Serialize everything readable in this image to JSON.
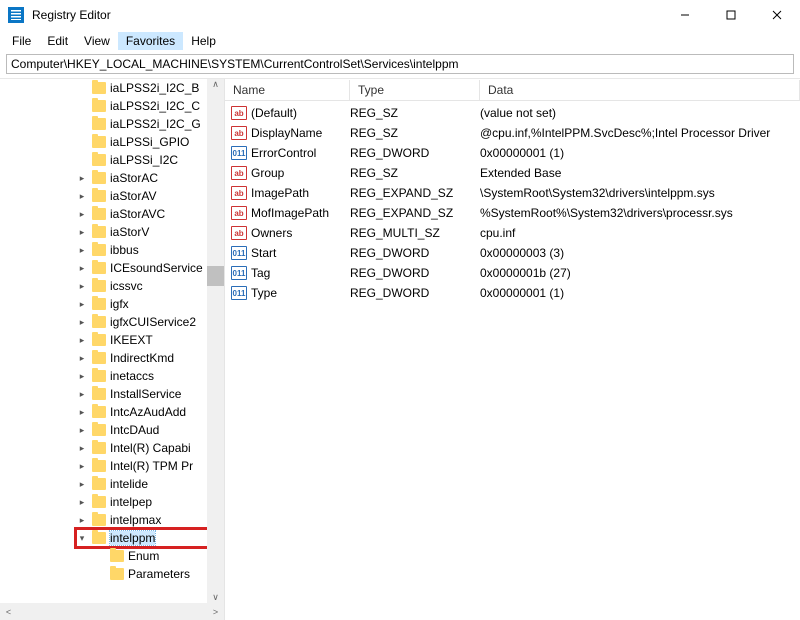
{
  "app": {
    "title": "Registry Editor"
  },
  "menu": {
    "file": "File",
    "edit": "Edit",
    "view": "View",
    "favorites": "Favorites",
    "help": "Help"
  },
  "address": "Computer\\HKEY_LOCAL_MACHINE\\SYSTEM\\CurrentControlSet\\Services\\intelppm",
  "tree": [
    {
      "label": "iaLPSS2i_I2C_B",
      "exp": ""
    },
    {
      "label": "iaLPSS2i_I2C_C",
      "exp": ""
    },
    {
      "label": "iaLPSS2i_I2C_G",
      "exp": ""
    },
    {
      "label": "iaLPSSi_GPIO",
      "exp": ""
    },
    {
      "label": "iaLPSSi_I2C",
      "exp": ""
    },
    {
      "label": "iaStorAC",
      "exp": ">"
    },
    {
      "label": "iaStorAV",
      "exp": ">"
    },
    {
      "label": "iaStorAVC",
      "exp": ">"
    },
    {
      "label": "iaStorV",
      "exp": ">"
    },
    {
      "label": "ibbus",
      "exp": ">"
    },
    {
      "label": "ICEsoundService",
      "exp": ">"
    },
    {
      "label": "icssvc",
      "exp": ">"
    },
    {
      "label": "igfx",
      "exp": ">"
    },
    {
      "label": "igfxCUIService2",
      "exp": ">"
    },
    {
      "label": "IKEEXT",
      "exp": ">"
    },
    {
      "label": "IndirectKmd",
      "exp": ">"
    },
    {
      "label": "inetaccs",
      "exp": ">"
    },
    {
      "label": "InstallService",
      "exp": ">"
    },
    {
      "label": "IntcAzAudAdd",
      "exp": ">"
    },
    {
      "label": "IntcDAud",
      "exp": ">"
    },
    {
      "label": "Intel(R) Capabi",
      "exp": ">"
    },
    {
      "label": "Intel(R) TPM Pr",
      "exp": ">"
    },
    {
      "label": "intelide",
      "exp": ">"
    },
    {
      "label": "intelpep",
      "exp": ">"
    },
    {
      "label": "intelpmax",
      "exp": ">"
    },
    {
      "label": "intelppm",
      "exp": "v",
      "selected": true,
      "highlighted": true
    },
    {
      "label": "Enum",
      "exp": "",
      "child": true
    },
    {
      "label": "Parameters",
      "exp": "",
      "child": true
    }
  ],
  "columns": {
    "name": "Name",
    "type": "Type",
    "data": "Data"
  },
  "values": [
    {
      "icon": "sz",
      "name": "(Default)",
      "type": "REG_SZ",
      "data": "(value not set)"
    },
    {
      "icon": "sz",
      "name": "DisplayName",
      "type": "REG_SZ",
      "data": "@cpu.inf,%IntelPPM.SvcDesc%;Intel Processor Driver"
    },
    {
      "icon": "dw",
      "name": "ErrorControl",
      "type": "REG_DWORD",
      "data": "0x00000001 (1)"
    },
    {
      "icon": "sz",
      "name": "Group",
      "type": "REG_SZ",
      "data": "Extended Base"
    },
    {
      "icon": "sz",
      "name": "ImagePath",
      "type": "REG_EXPAND_SZ",
      "data": "\\SystemRoot\\System32\\drivers\\intelppm.sys"
    },
    {
      "icon": "sz",
      "name": "MofImagePath",
      "type": "REG_EXPAND_SZ",
      "data": "%SystemRoot%\\System32\\drivers\\processr.sys"
    },
    {
      "icon": "sz",
      "name": "Owners",
      "type": "REG_MULTI_SZ",
      "data": "cpu.inf"
    },
    {
      "icon": "dw",
      "name": "Start",
      "type": "REG_DWORD",
      "data": "0x00000003 (3)"
    },
    {
      "icon": "dw",
      "name": "Tag",
      "type": "REG_DWORD",
      "data": "0x0000001b (27)"
    },
    {
      "icon": "dw",
      "name": "Type",
      "type": "REG_DWORD",
      "data": "0x00000001 (1)"
    }
  ],
  "icon_text": {
    "sz": "ab",
    "dw": "011"
  }
}
